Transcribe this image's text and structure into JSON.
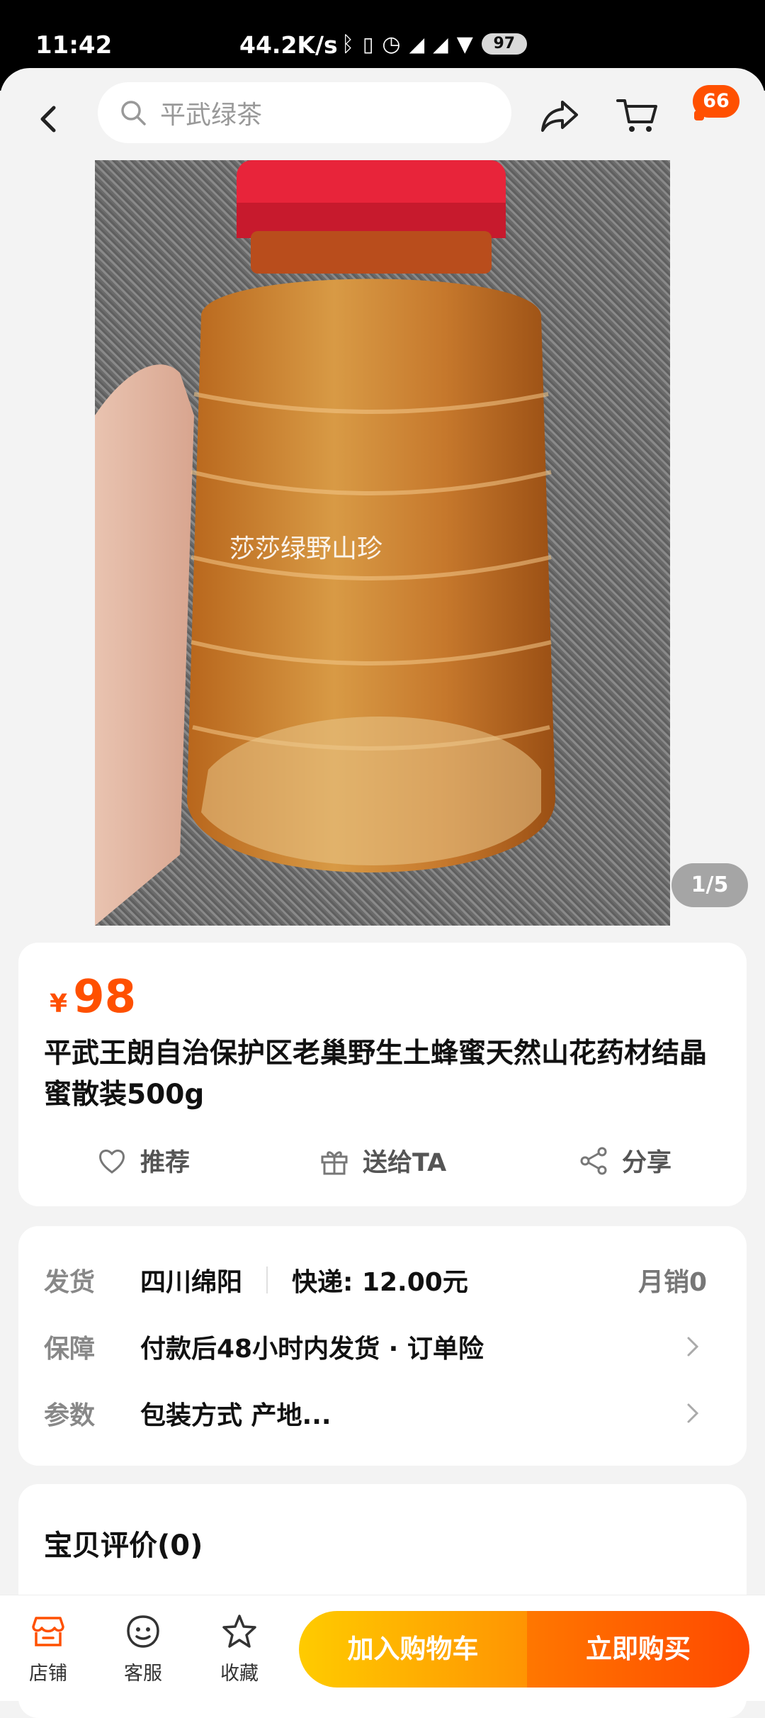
{
  "status_bar": {
    "time": "11:42",
    "network_speed": "44.2K/s",
    "battery": "97"
  },
  "nav": {
    "search_placeholder": "平武绿茶",
    "message_badge": "66",
    "icons": {
      "back": "chevron-left-icon",
      "search": "search-icon",
      "share": "share-arrow-icon",
      "cart": "cart-icon"
    }
  },
  "gallery": {
    "watermark": "莎莎绿野山珍",
    "counter": "1/5"
  },
  "product": {
    "currency": "¥",
    "price": "98",
    "title": "平武王朗自治保护区老巢野生土蜂蜜天然山花药材结晶蜜散装500g",
    "actions": [
      {
        "label": "推荐",
        "icon": "heart-icon"
      },
      {
        "label": "送给TA",
        "icon": "gift-icon"
      },
      {
        "label": "分享",
        "icon": "share-icon"
      }
    ]
  },
  "info": {
    "shipping": {
      "label": "发货",
      "origin": "四川绵阳",
      "express": "快递: 12.00元",
      "monthly_sales": "月销0"
    },
    "guarantee": {
      "label": "保障",
      "value": "付款后48小时内发货 · 订单险"
    },
    "params": {
      "label": "参数",
      "value": "包装方式 产地..."
    }
  },
  "reviews": {
    "title": "宝贝评价(0)"
  },
  "bottom_bar": {
    "tabs": [
      {
        "label": "店铺",
        "icon": "store-icon"
      },
      {
        "label": "客服",
        "icon": "customer-service-icon"
      },
      {
        "label": "收藏",
        "icon": "star-icon"
      }
    ],
    "add_to_cart": "加入购物车",
    "buy_now": "立即购买"
  },
  "colors": {
    "accent": "#ff5000",
    "cart_button": "#ffb400",
    "buy_button": "#ff5a00"
  }
}
